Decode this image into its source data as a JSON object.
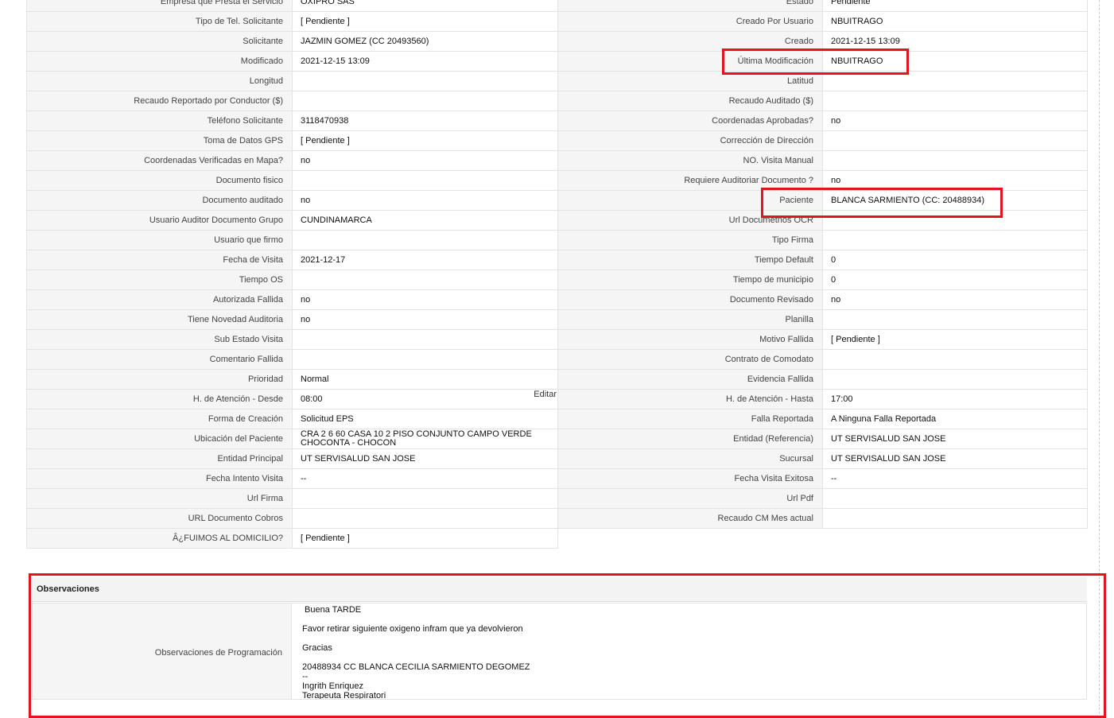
{
  "left_rows": [
    {
      "label": "Empresa que Presta el Servicio",
      "value": "OXIPRO SAS"
    },
    {
      "label": "Tipo de Tel. Solicitante",
      "value": "[ Pendiente ]"
    },
    {
      "label": "Solicitante",
      "value": "JAZMIN GOMEZ (CC 20493560)"
    },
    {
      "label": "Modificado",
      "value": "2021-12-15 13:09"
    },
    {
      "label": "Longitud",
      "value": ""
    },
    {
      "label": "Recaudo Reportado por Conductor ($)",
      "value": ""
    },
    {
      "label": "Teléfono Solicitante",
      "value": "3118470938"
    },
    {
      "label": "Toma de Datos GPS",
      "value": "[ Pendiente ]"
    },
    {
      "label": "Coordenadas Verificadas en Mapa?",
      "value": "no"
    },
    {
      "label": "Documento fisico",
      "value": ""
    },
    {
      "label": "Documento auditado",
      "value": "no"
    },
    {
      "label": "Usuario Auditor Documento Grupo",
      "value": "CUNDINAMARCA"
    },
    {
      "label": "Usuario que firmo",
      "value": ""
    },
    {
      "label": "Fecha de Visita",
      "value": "2021-12-17"
    },
    {
      "label": "Tiempo OS",
      "value": ""
    },
    {
      "label": "Autorizada Fallida",
      "value": "no"
    },
    {
      "label": "Tiene Novedad Auditoria",
      "value": "no"
    },
    {
      "label": "Sub Estado Visita",
      "value": ""
    },
    {
      "label": "Comentario Fallida",
      "value": ""
    },
    {
      "label": "Prioridad",
      "value": "Normal"
    },
    {
      "label": "H. de Atención - Desde",
      "value": "08:00",
      "edit": "Editar"
    },
    {
      "label": "Forma de Creación",
      "value": "Solicitud EPS"
    },
    {
      "label": "Ubicación del Paciente",
      "value": "CRA 2 6 60 CASA 10 2 PISO CONJUNTO CAMPO VERDE CHOCONTA - CHOCON"
    },
    {
      "label": "Entidad Principal",
      "value": "UT SERVISALUD SAN JOSE"
    },
    {
      "label": "Fecha Intento Visita",
      "value": "--"
    },
    {
      "label": "Url Firma",
      "value": ""
    },
    {
      "label": "URL Documento Cobros",
      "value": ""
    },
    {
      "label": "Â¿FUIMOS AL DOMICILIO?",
      "value": "[ Pendiente ]"
    }
  ],
  "right_rows": [
    {
      "label": "Estado",
      "value": "Pendiente"
    },
    {
      "label": "Creado Por Usuario",
      "value": "NBUITRAGO"
    },
    {
      "label": "Creado",
      "value": "2021-12-15 13:09"
    },
    {
      "label": "Última Modificación",
      "value": "NBUITRAGO"
    },
    {
      "label": "Latitud",
      "value": ""
    },
    {
      "label": "Recaudo Auditado ($)",
      "value": ""
    },
    {
      "label": "Coordenadas Aprobadas?",
      "value": "no"
    },
    {
      "label": "Corrección de Dirección",
      "value": ""
    },
    {
      "label": "NO. Visita Manual",
      "value": ""
    },
    {
      "label": "Requiere Auditoriar Documento ?",
      "value": "no"
    },
    {
      "label": "Paciente",
      "value": "BLANCA SARMIENTO (CC: 20488934)"
    },
    {
      "label": "Url Documetnos OCR",
      "value": ""
    },
    {
      "label": "Tipo Firma",
      "value": ""
    },
    {
      "label": "Tiempo Default",
      "value": "0"
    },
    {
      "label": "Tiempo de municipio",
      "value": "0"
    },
    {
      "label": "Documento Revisado",
      "value": "no"
    },
    {
      "label": "Planilla",
      "value": ""
    },
    {
      "label": "Motivo Fallida",
      "value": "[ Pendiente ]"
    },
    {
      "label": "Contrato de Comodato",
      "value": ""
    },
    {
      "label": "Evidencia Fallida",
      "value": ""
    },
    {
      "label": "H. de Atención - Hasta",
      "value": "17:00"
    },
    {
      "label": "Falla Reportada",
      "value": "A Ninguna Falla Reportada"
    },
    {
      "label": "Entidad (Referencia)",
      "value": "UT SERVISALUD SAN JOSE"
    },
    {
      "label": "Sucursal",
      "value": "UT SERVISALUD SAN JOSE"
    },
    {
      "label": "Fecha Visita Exitosa",
      "value": "--"
    },
    {
      "label": "Url Pdf",
      "value": ""
    },
    {
      "label": "Recaudo CM Mes actual",
      "value": ""
    }
  ],
  "observaciones": {
    "title": "Observaciones",
    "label": "Observaciones de Programación",
    "lines": {
      "greeting": "Buena TARDE",
      "body": "Favor retirar siguiente oxigeno infram que ya devolvieron",
      "thanks": "Gracias",
      "patient": "20488934 CC BLANCA CECILIA SARMIENTO DEGOMEZ",
      "sep": "--",
      "signer": "Ingrith Enriquez",
      "role": "Terapeuta Respiratori"
    }
  },
  "colors": {
    "highlight": "#e0151f",
    "label_bg": "#f5f5f5",
    "border": "#e3e3e3"
  }
}
